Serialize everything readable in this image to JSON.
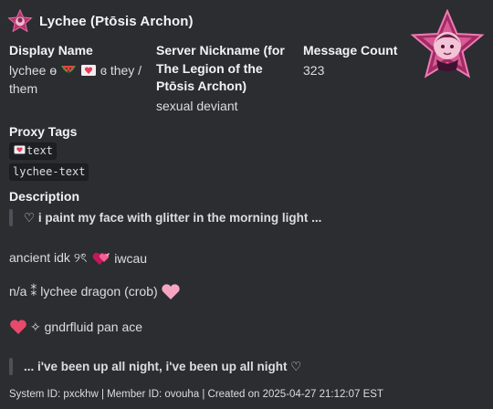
{
  "author": {
    "name": "Lychee (Ptōsis Archon)",
    "avatar_icon": "pink-star-avatar-icon"
  },
  "thumbnail": {
    "icon": "character-star-portrait-icon"
  },
  "fields": {
    "display_name": {
      "title": "Display Name",
      "value_prefix": "lychee ɵ",
      "value_emojis": [
        "watermelon-emoji",
        "heart-letter-emoji"
      ],
      "value_suffix_line1": "ɞ they /",
      "value_line2": "them"
    },
    "server_nickname": {
      "title_line1": "Server Nickname (for",
      "title_line2": "The Legion of the",
      "title_line3": "Ptōsis Archon)",
      "value": "sexual deviant"
    },
    "message_count": {
      "title": "Message Count",
      "value": "323"
    }
  },
  "proxy_tags": {
    "title": "Proxy Tags",
    "tag1_emoji": "heart-letter-emoji",
    "tag1_text": "text",
    "tag2": "lychee-text"
  },
  "description": {
    "title": "Description",
    "quote1": "♡ i paint my face with glitter in the morning light ...",
    "line1_text": "ancient idk ୨ৎ",
    "line1_emoji": "pink-hearts-emoji",
    "line1_tail": "iwcau",
    "line2_text": "n/a ⁑ lychee dragon (crob)",
    "line2_emoji": "pink-heart-emoji",
    "line3_emoji": "heart-emoji",
    "line3_text": "✧ gndrfluid pan ace",
    "quote2": "... i've been up all night, i've been up all night ♡"
  },
  "footer": "System ID: pxckhw | Member ID: ovouha | Created on 2025-04-27 21:12:07 EST",
  "colors": {
    "background": "#2b2d31",
    "heart_pink": "#f4a6c0",
    "heart_red": "#e0405f",
    "star_magenta": "#b3346e"
  }
}
